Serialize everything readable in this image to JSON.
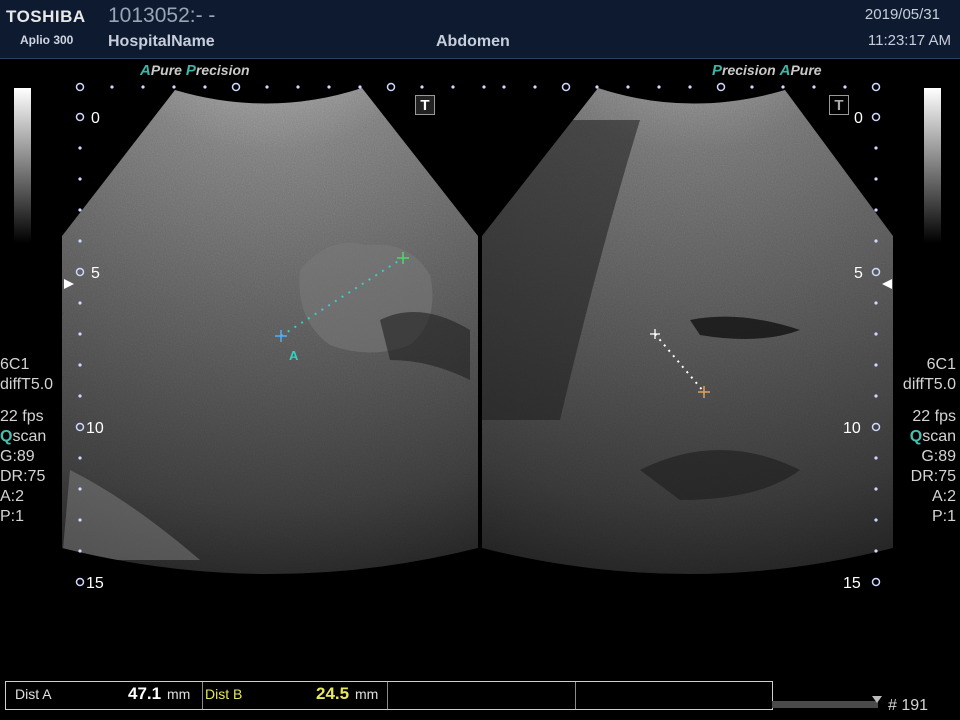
{
  "header": {
    "brand": "TOSHIBA",
    "model": "Aplio 300",
    "patient_id": "1013052:- -",
    "hospital": "HospitalName",
    "exam": "Abdomen",
    "date": "2019/05/31",
    "time": "11:23:17 AM"
  },
  "left_view": {
    "mode_a": "A",
    "mode_pure": "Pure",
    "mode_p": "P",
    "mode_precision": "recision",
    "depth_labels": [
      "0",
      "5",
      "10",
      "15"
    ],
    "marker_label": "A",
    "t_label": "T"
  },
  "right_view": {
    "mode_p": "P",
    "mode_precision": "recision",
    "mode_a": "A",
    "mode_pure": "Pure",
    "depth_labels": [
      "0",
      "5",
      "10",
      "15"
    ],
    "t_label": "T"
  },
  "left_params": {
    "probe": "6C1",
    "freq": "diffT5.0",
    "fps": "22 fps",
    "scan_q": "Q",
    "scan_rest": "scan",
    "gain": "G:89",
    "dr": "DR:75",
    "a": "A:2",
    "p": "P:1"
  },
  "right_params": {
    "probe": "6C1",
    "freq": "diffT5.0",
    "fps": "22 fps",
    "scan_q": "Q",
    "scan_rest": "scan",
    "gain": "G:89",
    "dr": "DR:75",
    "a": "A:2",
    "p": "P:1"
  },
  "measurements": {
    "dist_a_label": "Dist A",
    "dist_a_value": "47.1",
    "dist_a_unit": "mm",
    "dist_b_label": "Dist B",
    "dist_b_value": "24.5",
    "dist_b_unit": "mm"
  },
  "cine": {
    "frame": "# 191"
  },
  "colors": {
    "header_bg": "#0d1a30",
    "accent_teal": "#3fb6a8",
    "dist_b_value": "#e8e85a",
    "caliper_a": "#35d0c0",
    "caliper_b": "#e0a060"
  }
}
